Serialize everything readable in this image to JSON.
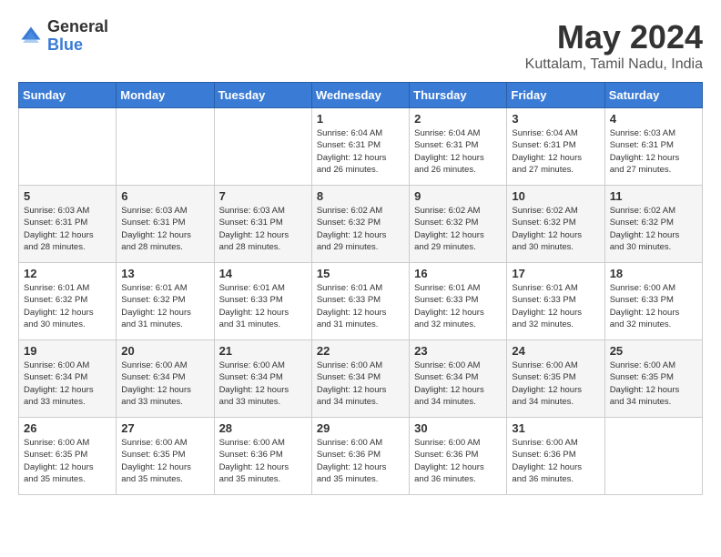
{
  "logo": {
    "general": "General",
    "blue": "Blue"
  },
  "title": "May 2024",
  "subtitle": "Kuttalam, Tamil Nadu, India",
  "days_header": [
    "Sunday",
    "Monday",
    "Tuesday",
    "Wednesday",
    "Thursday",
    "Friday",
    "Saturday"
  ],
  "weeks": [
    [
      {
        "day": "",
        "info": ""
      },
      {
        "day": "",
        "info": ""
      },
      {
        "day": "",
        "info": ""
      },
      {
        "day": "1",
        "info": "Sunrise: 6:04 AM\nSunset: 6:31 PM\nDaylight: 12 hours\nand 26 minutes."
      },
      {
        "day": "2",
        "info": "Sunrise: 6:04 AM\nSunset: 6:31 PM\nDaylight: 12 hours\nand 26 minutes."
      },
      {
        "day": "3",
        "info": "Sunrise: 6:04 AM\nSunset: 6:31 PM\nDaylight: 12 hours\nand 27 minutes."
      },
      {
        "day": "4",
        "info": "Sunrise: 6:03 AM\nSunset: 6:31 PM\nDaylight: 12 hours\nand 27 minutes."
      }
    ],
    [
      {
        "day": "5",
        "info": "Sunrise: 6:03 AM\nSunset: 6:31 PM\nDaylight: 12 hours\nand 28 minutes."
      },
      {
        "day": "6",
        "info": "Sunrise: 6:03 AM\nSunset: 6:31 PM\nDaylight: 12 hours\nand 28 minutes."
      },
      {
        "day": "7",
        "info": "Sunrise: 6:03 AM\nSunset: 6:31 PM\nDaylight: 12 hours\nand 28 minutes."
      },
      {
        "day": "8",
        "info": "Sunrise: 6:02 AM\nSunset: 6:32 PM\nDaylight: 12 hours\nand 29 minutes."
      },
      {
        "day": "9",
        "info": "Sunrise: 6:02 AM\nSunset: 6:32 PM\nDaylight: 12 hours\nand 29 minutes."
      },
      {
        "day": "10",
        "info": "Sunrise: 6:02 AM\nSunset: 6:32 PM\nDaylight: 12 hours\nand 30 minutes."
      },
      {
        "day": "11",
        "info": "Sunrise: 6:02 AM\nSunset: 6:32 PM\nDaylight: 12 hours\nand 30 minutes."
      }
    ],
    [
      {
        "day": "12",
        "info": "Sunrise: 6:01 AM\nSunset: 6:32 PM\nDaylight: 12 hours\nand 30 minutes."
      },
      {
        "day": "13",
        "info": "Sunrise: 6:01 AM\nSunset: 6:32 PM\nDaylight: 12 hours\nand 31 minutes."
      },
      {
        "day": "14",
        "info": "Sunrise: 6:01 AM\nSunset: 6:33 PM\nDaylight: 12 hours\nand 31 minutes."
      },
      {
        "day": "15",
        "info": "Sunrise: 6:01 AM\nSunset: 6:33 PM\nDaylight: 12 hours\nand 31 minutes."
      },
      {
        "day": "16",
        "info": "Sunrise: 6:01 AM\nSunset: 6:33 PM\nDaylight: 12 hours\nand 32 minutes."
      },
      {
        "day": "17",
        "info": "Sunrise: 6:01 AM\nSunset: 6:33 PM\nDaylight: 12 hours\nand 32 minutes."
      },
      {
        "day": "18",
        "info": "Sunrise: 6:00 AM\nSunset: 6:33 PM\nDaylight: 12 hours\nand 32 minutes."
      }
    ],
    [
      {
        "day": "19",
        "info": "Sunrise: 6:00 AM\nSunset: 6:34 PM\nDaylight: 12 hours\nand 33 minutes."
      },
      {
        "day": "20",
        "info": "Sunrise: 6:00 AM\nSunset: 6:34 PM\nDaylight: 12 hours\nand 33 minutes."
      },
      {
        "day": "21",
        "info": "Sunrise: 6:00 AM\nSunset: 6:34 PM\nDaylight: 12 hours\nand 33 minutes."
      },
      {
        "day": "22",
        "info": "Sunrise: 6:00 AM\nSunset: 6:34 PM\nDaylight: 12 hours\nand 34 minutes."
      },
      {
        "day": "23",
        "info": "Sunrise: 6:00 AM\nSunset: 6:34 PM\nDaylight: 12 hours\nand 34 minutes."
      },
      {
        "day": "24",
        "info": "Sunrise: 6:00 AM\nSunset: 6:35 PM\nDaylight: 12 hours\nand 34 minutes."
      },
      {
        "day": "25",
        "info": "Sunrise: 6:00 AM\nSunset: 6:35 PM\nDaylight: 12 hours\nand 34 minutes."
      }
    ],
    [
      {
        "day": "26",
        "info": "Sunrise: 6:00 AM\nSunset: 6:35 PM\nDaylight: 12 hours\nand 35 minutes."
      },
      {
        "day": "27",
        "info": "Sunrise: 6:00 AM\nSunset: 6:35 PM\nDaylight: 12 hours\nand 35 minutes."
      },
      {
        "day": "28",
        "info": "Sunrise: 6:00 AM\nSunset: 6:36 PM\nDaylight: 12 hours\nand 35 minutes."
      },
      {
        "day": "29",
        "info": "Sunrise: 6:00 AM\nSunset: 6:36 PM\nDaylight: 12 hours\nand 35 minutes."
      },
      {
        "day": "30",
        "info": "Sunrise: 6:00 AM\nSunset: 6:36 PM\nDaylight: 12 hours\nand 36 minutes."
      },
      {
        "day": "31",
        "info": "Sunrise: 6:00 AM\nSunset: 6:36 PM\nDaylight: 12 hours\nand 36 minutes."
      },
      {
        "day": "",
        "info": ""
      }
    ]
  ]
}
